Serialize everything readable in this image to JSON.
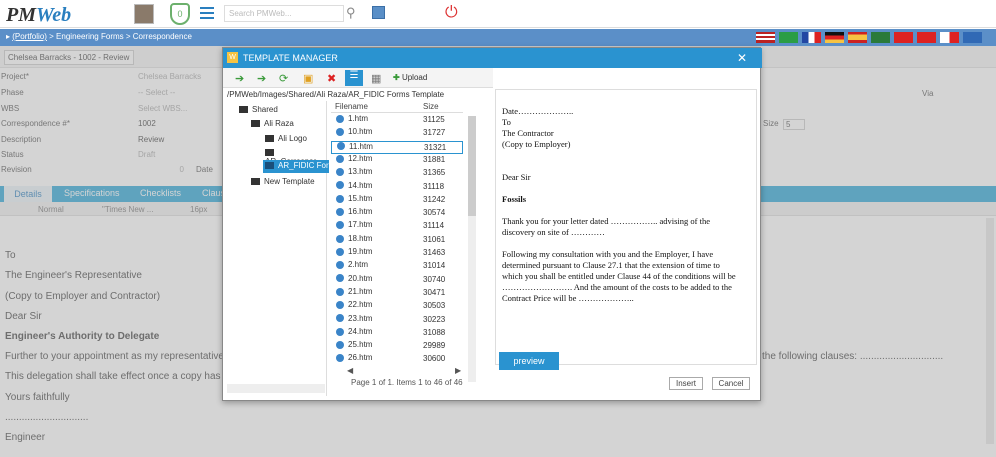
{
  "app": {
    "logo_main": "PM",
    "logo_accent": "Web",
    "search_placeholder": "Search PMWeb...",
    "badge_count": "0"
  },
  "nav": {
    "portfolio": "(Portfolio)",
    "path": " > Engineering Forms > Correspondence"
  },
  "header": {
    "project_select": "Chelsea Barracks - 1002 - Review"
  },
  "form": {
    "labels": [
      "Project*",
      "Phase",
      "WBS",
      "Correspondence #*",
      "Description",
      "Status",
      "Revision"
    ],
    "values": [
      "Chelsea Barracks",
      "-- Select --",
      "Select WBS...",
      "1002",
      "Review",
      "Draft",
      "0"
    ],
    "date_label": "Date",
    "size_label": "Size",
    "size_value": "5",
    "via_label": "Via"
  },
  "tabs": [
    "Details",
    "Specifications",
    "Checklists",
    "Claus"
  ],
  "editor": {
    "style": "Normal",
    "font": "\"Times New ...",
    "size": "16px"
  },
  "body_text": [
    "To",
    "The Engineer's Representative",
    "(Copy to Employer and Contractor)",
    "Dear Sir",
    "Engineer's Authority to Delegate",
    "Further to your appointment as my representative f",
    "This delegation shall take effect once a copy has be",
    "Yours faithfully",
    "..............................",
    "Engineer"
  ],
  "body_right": "the following clauses: ..............................",
  "modal": {
    "title": "TEMPLATE MANAGER",
    "upload_label": "Upload",
    "path": "/PMWeb/Images/Shared/Ali Raza/AR_FIDIC Forms Template",
    "tree": [
      {
        "label": "Shared",
        "level": 0
      },
      {
        "label": "Ali Raza",
        "level": 1
      },
      {
        "label": "Ali Logo",
        "level": 2
      },
      {
        "label": "AR_Correspor",
        "level": 2
      },
      {
        "label": "AR_FIDIC Form",
        "level": 2,
        "selected": true
      },
      {
        "label": "New Template",
        "level": 1
      }
    ],
    "file_headers": {
      "name": "Filename",
      "size": "Size"
    },
    "files": [
      {
        "name": "1.htm",
        "size": "31125"
      },
      {
        "name": "10.htm",
        "size": "31727"
      },
      {
        "name": "11.htm",
        "size": "31321"
      },
      {
        "name": "12.htm",
        "size": "31881"
      },
      {
        "name": "13.htm",
        "size": "31365"
      },
      {
        "name": "14.htm",
        "size": "31118"
      },
      {
        "name": "15.htm",
        "size": "31242"
      },
      {
        "name": "16.htm",
        "size": "30574"
      },
      {
        "name": "17.htm",
        "size": "31114"
      },
      {
        "name": "18.htm",
        "size": "31061"
      },
      {
        "name": "19.htm",
        "size": "31463"
      },
      {
        "name": "2.htm",
        "size": "31014"
      },
      {
        "name": "20.htm",
        "size": "30740"
      },
      {
        "name": "21.htm",
        "size": "30471"
      },
      {
        "name": "22.htm",
        "size": "30503"
      },
      {
        "name": "23.htm",
        "size": "30223"
      },
      {
        "name": "24.htm",
        "size": "31088"
      },
      {
        "name": "25.htm",
        "size": "29989"
      },
      {
        "name": "26.htm",
        "size": "30600"
      }
    ],
    "pager": "Page 1 of 1. Items 1 to 46 of 46",
    "preview_lines": [
      "Date………………..",
      "To",
      "The Contractor",
      "(Copy to Employer)",
      "",
      "",
      "Dear Sir",
      "",
      "Fossils",
      "",
      "Thank you for your letter dated …………….. advising of the discovery on site of …………",
      "",
      "Following my consultation with you and the Employer, I have determined pursuant to Clause 27.1 that the extension of time to which you shall be entitled under Clause 44 of the conditions will be ……………………. And the amount of the costs to be added to the Contract Price will be ……………….."
    ],
    "preview_button": "preview",
    "insert_button": "Insert",
    "cancel_button": "Cancel"
  },
  "colors": {
    "accent": "#2a93d0",
    "nav": "#5b8fc8",
    "tab": "#2aa6d8"
  }
}
